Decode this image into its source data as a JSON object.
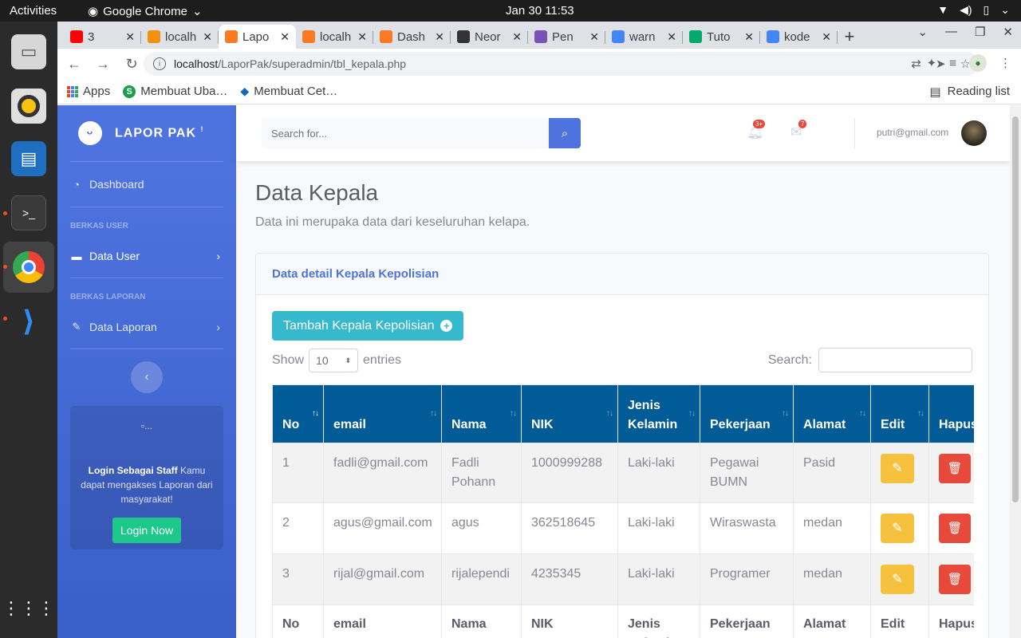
{
  "os": {
    "activities": "Activities",
    "app_name": "Google Chrome",
    "clock": "Jan 30  11:53"
  },
  "browser": {
    "tabs": [
      {
        "title": "3",
        "icon": "youtube-icon",
        "color": "#ff0000"
      },
      {
        "title": "localh",
        "icon": "phpmyadmin-icon",
        "color": "#f29111"
      },
      {
        "title": "Lapo",
        "icon": "xampp-icon",
        "color": "#fb7a24",
        "active": true
      },
      {
        "title": "localh",
        "icon": "xampp-icon",
        "color": "#fb7a24"
      },
      {
        "title": "Dash",
        "icon": "xampp-icon",
        "color": "#fb7a24"
      },
      {
        "title": "Neor",
        "icon": "github-icon",
        "color": "#333333"
      },
      {
        "title": "Pen",
        "icon": "bootstrap-icon",
        "color": "#7952b3"
      },
      {
        "title": "warn",
        "icon": "google-icon",
        "color": "#4285f4"
      },
      {
        "title": "Tuto",
        "icon": "w3schools-icon",
        "color": "#04aa6d"
      },
      {
        "title": "kode",
        "icon": "google-icon",
        "color": "#4285f4"
      }
    ],
    "url_host": "localhost",
    "url_path": "/LaporPak/superadmin/tbl_kepala.php",
    "bookmarks": [
      {
        "label": "Apps"
      },
      {
        "label": "Membuat Uba…"
      },
      {
        "label": "Membuat Cet…"
      }
    ],
    "reading_list": "Reading list"
  },
  "app": {
    "brand": "LAPOR PAK",
    "brand_sup": "!",
    "sidebar": {
      "dashboard": "Dashboard",
      "heading_user": "BERKAS USER",
      "data_user": "Data User",
      "heading_laporan": "BERKAS LAPORAN",
      "data_laporan": "Data Laporan",
      "card_img_alt": "...",
      "card_bold": "Login Sebagai Staff",
      "card_text": " Kamu dapat mengakses Laporan dari masyarakat!",
      "card_button": "Login Now"
    },
    "topbar": {
      "search_placeholder": "Search for...",
      "alerts_badge": "3+",
      "messages_badge": "7",
      "user_email": "putri@gmail.com"
    },
    "page": {
      "title": "Data Kepala",
      "subtitle": "Data ini merupaka data dari keseluruhan kelapa."
    },
    "card": {
      "header": "Data detail Kepala Kepolisian",
      "add_button": "Tambah Kepala Kepolisian",
      "show_label": "Show",
      "entries_value": "10",
      "entries_label": "entries",
      "search_label": "Search:"
    },
    "table": {
      "headers": [
        "No",
        "email",
        "Nama",
        "NIK",
        "Jenis Kelamin",
        "Pekerjaan",
        "Alamat",
        "Edit",
        "Hapus"
      ],
      "rows": [
        {
          "no": "1",
          "email": "fadli@gmail.com",
          "nama": "Fadli Pohann",
          "nik": "1000999288",
          "jk": "Laki-laki",
          "pekerjaan": "Pegawai BUMN",
          "alamat": "Pasid"
        },
        {
          "no": "2",
          "email": "agus@gmail.com",
          "nama": "agus",
          "nik": "362518645",
          "jk": "Laki-laki",
          "pekerjaan": "Wiraswasta",
          "alamat": "medan"
        },
        {
          "no": "3",
          "email": "rijal@gmail.com",
          "nama": "rijalependi",
          "nik": "4235345",
          "jk": "Laki-laki",
          "pekerjaan": "Programer",
          "alamat": "medan"
        }
      ]
    }
  }
}
